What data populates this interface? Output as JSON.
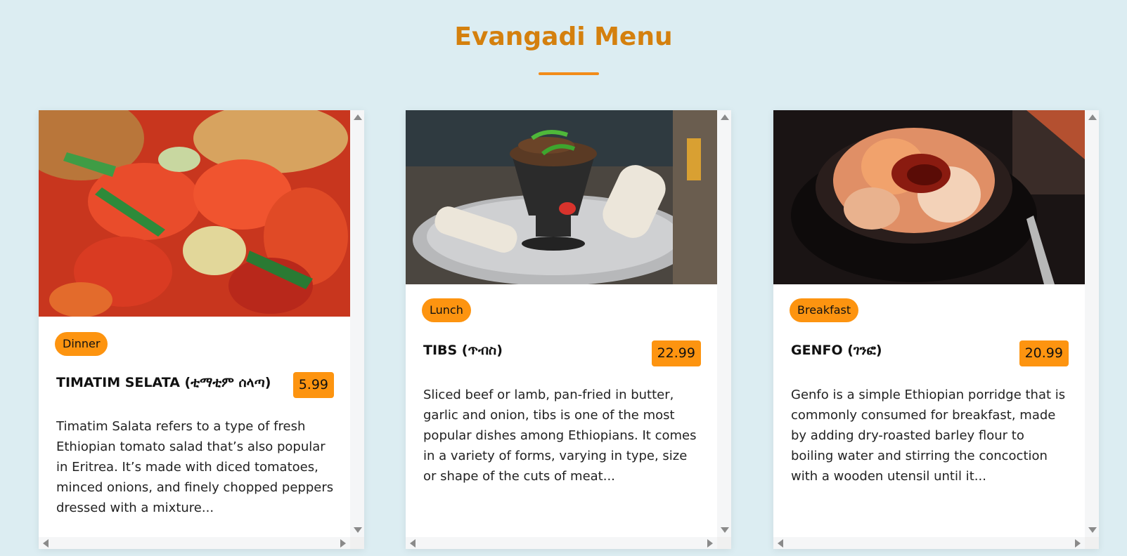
{
  "header": {
    "title": "Evangadi Menu"
  },
  "cards": [
    {
      "image_alt": "tomato-salad-photo",
      "category": "Dinner",
      "name": "TIMATIM SELATA (ቲማቲም ሰላጣ)",
      "price": "5.99",
      "description": "Timatim Salata refers to a type of fresh Ethiopian tomato salad that’s also popular in Eritrea. It’s made with diced tomatoes, minced onions, and finely chopped peppers dressed with a mixture..."
    },
    {
      "image_alt": "tibs-dish-photo",
      "category": "Lunch",
      "name": "TIBS (ጥብስ)",
      "price": "22.99",
      "description": "Sliced beef or lamb, pan-fried in butter, garlic and onion, tibs is one of the most popular dishes among Ethiopians. It comes in a variety of forms, varying in type, size or shape of the cuts of meat..."
    },
    {
      "image_alt": "genfo-porridge-photo",
      "category": "Breakfast",
      "name": "GENFO (ገንፎ)",
      "price": "20.99",
      "description": "Genfo is a simple Ethiopian porridge that is commonly consumed for breakfast, made by adding dry-roasted barley flour to boiling water and stirring the concoction with a wooden utensil until it..."
    }
  ],
  "colors": {
    "background": "#dcedf2",
    "title": "#d4800e",
    "accent": "#fd9410"
  }
}
